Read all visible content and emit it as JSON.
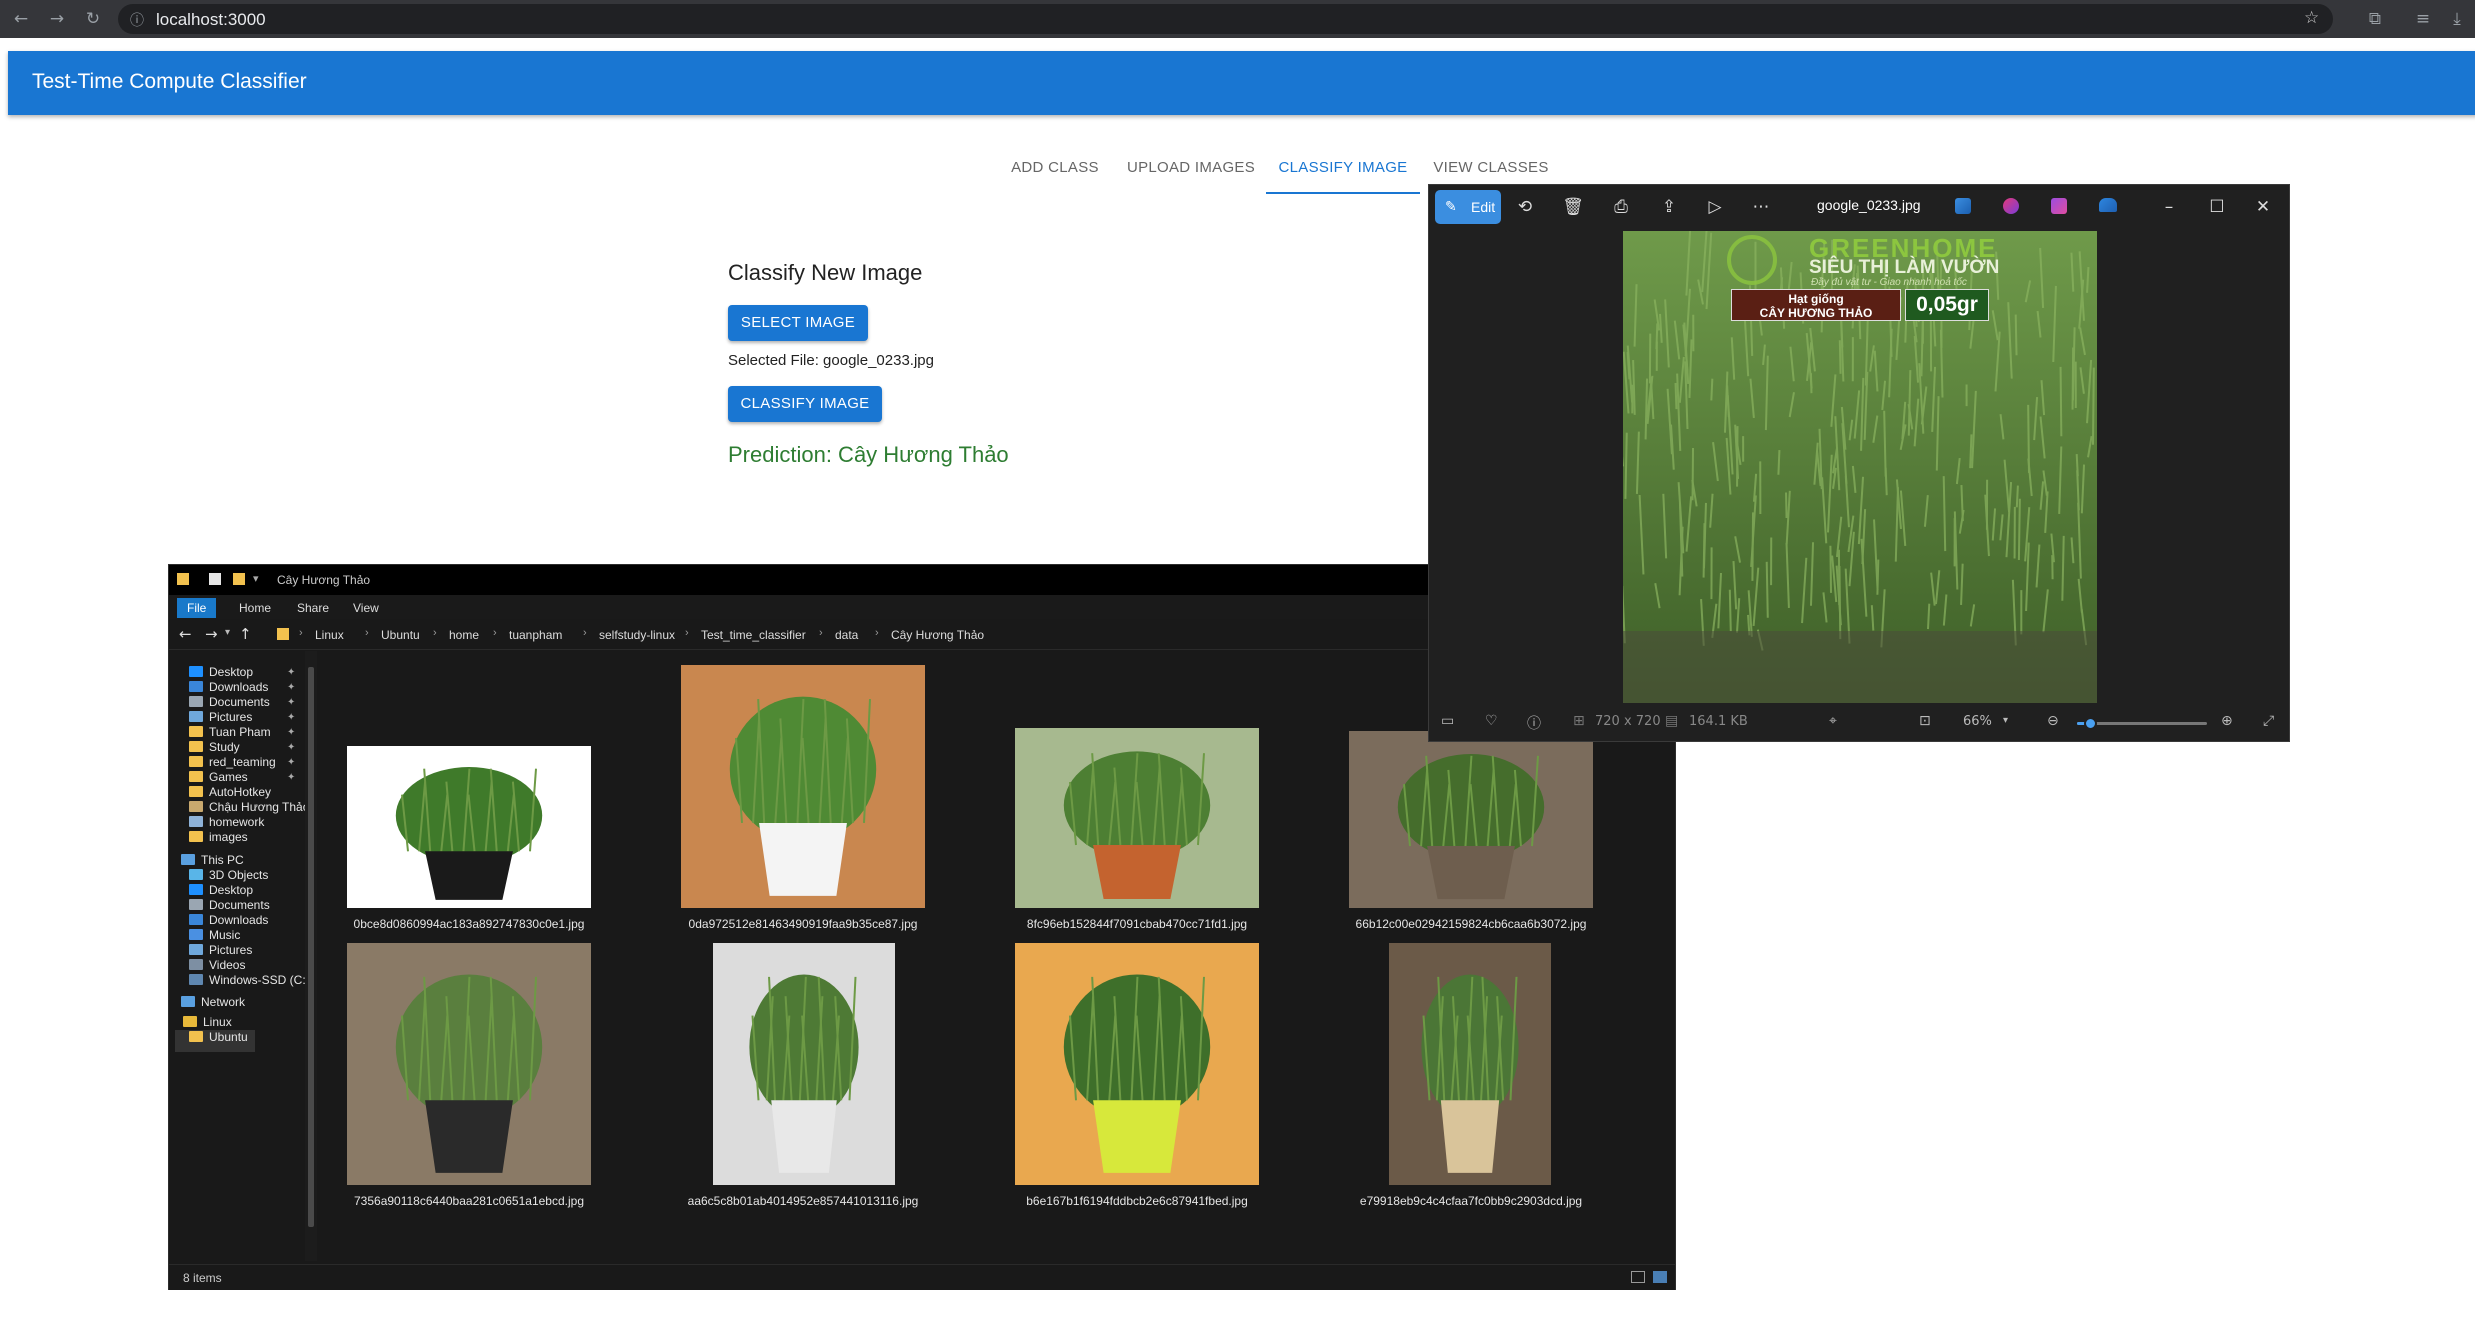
{
  "browser": {
    "url": "localhost:3000"
  },
  "app": {
    "title": "Test-Time Compute Classifier",
    "tabs": [
      "ADD CLASS",
      "UPLOAD IMAGES",
      "CLASSIFY IMAGE",
      "VIEW CLASSES"
    ],
    "active_tab": "CLASSIFY IMAGE",
    "classify": {
      "heading": "Classify New Image",
      "select_button": "SELECT IMAGE",
      "selected_file": "Selected File: google_0233.jpg",
      "classify_button": "CLASSIFY IMAGE",
      "prediction": "Prediction: Cây Hương Thảo"
    }
  },
  "photo_viewer": {
    "edit_label": "Edit",
    "filename": "google_0233.jpg",
    "image_text": {
      "brand": "GREENHOME",
      "store": "SIÊU THỊ LÀM VƯỜN",
      "slogan": "Đầy đủ vật tư - Giao nhanh hoả tốc",
      "seed_label_1": "Hạt giống",
      "seed_label_2": "CÂY HƯƠNG THẢO",
      "weight": "0,05gr"
    },
    "dimensions": "720 x 720",
    "file_size": "164.1 KB",
    "zoom": "66%",
    "zoom_fraction": 0.1
  },
  "explorer": {
    "title": "Cây Hương Thảo",
    "ribbon_tabs": [
      "File",
      "Home",
      "Share",
      "View"
    ],
    "breadcrumb": [
      "Linux",
      "Ubuntu",
      "home",
      "tuanpham",
      "selfstudy-linux",
      "Test_time_classifier",
      "data",
      "Cây Hương Thảo"
    ],
    "nav": [
      {
        "label": "Desktop",
        "pinned": true,
        "color": "#1e90ff"
      },
      {
        "label": "Downloads",
        "pinned": true,
        "color": "#3a86d9"
      },
      {
        "label": "Documents",
        "pinned": true,
        "color": "#9aa6b2"
      },
      {
        "label": "Pictures",
        "pinned": true,
        "color": "#6fa8dc"
      },
      {
        "label": "Tuan Pham",
        "pinned": true,
        "color": "#f2c14e"
      },
      {
        "label": "Study",
        "pinned": true,
        "color": "#f2c14e"
      },
      {
        "label": "red_teaming",
        "pinned": true,
        "color": "#f2c14e"
      },
      {
        "label": "Games",
        "pinned": true,
        "color": "#f2c14e"
      },
      {
        "label": "AutoHotkey",
        "pinned": false,
        "color": "#f2c14e"
      },
      {
        "label": "Chậu Hương Thảo",
        "pinned": false,
        "color": "#c9a96e"
      },
      {
        "label": "homework",
        "pinned": false,
        "color": "#8fb3d9"
      },
      {
        "label": "images",
        "pinned": false,
        "color": "#f2c14e"
      },
      {
        "label": "This PC",
        "pinned": false,
        "color": "#5aa0e0"
      },
      {
        "label": "3D Objects",
        "pinned": false,
        "color": "#59b5e8"
      },
      {
        "label": "Desktop",
        "pinned": false,
        "color": "#1e90ff"
      },
      {
        "label": "Documents",
        "pinned": false,
        "color": "#9aa6b2"
      },
      {
        "label": "Downloads",
        "pinned": false,
        "color": "#3a86d9"
      },
      {
        "label": "Music",
        "pinned": false,
        "color": "#4a90e2"
      },
      {
        "label": "Pictures",
        "pinned": false,
        "color": "#6fa8dc"
      },
      {
        "label": "Videos",
        "pinned": false,
        "color": "#7d8fa3"
      },
      {
        "label": "Windows-SSD (C:)",
        "pinned": false,
        "color": "#5f87b0"
      },
      {
        "label": "Network",
        "pinned": false,
        "color": "#5aa0e0"
      },
      {
        "label": "Linux",
        "pinned": false,
        "color": "#e8b93a"
      },
      {
        "label": "Ubuntu",
        "pinned": false,
        "color": "#f2c14e"
      }
    ],
    "files": [
      {
        "name": "0bce8d0860994ac183a892747830c0e1.jpg",
        "bg": "#ffffff",
        "pot": "#1a1a1a",
        "plant": "#3f7a2a"
      },
      {
        "name": "0da972512e81463490919faa9b35ce87.jpg",
        "bg": "#c9874f",
        "pot": "#f4f4f4",
        "plant": "#4f8a34"
      },
      {
        "name": "8fc96eb152844f7091cbab470cc71fd1.jpg",
        "bg": "#a7b98f",
        "pot": "#c4632f",
        "plant": "#4d7f33"
      },
      {
        "name": "66b12c00e02942159824cb6caa6b3072.jpg",
        "bg": "#7b6c5c",
        "pot": "#6e5e4e",
        "plant": "#456d2c"
      },
      {
        "name": "7356a90118c6440baa281c0651a1ebcd.jpg",
        "bg": "#8a7a66",
        "pot": "#2a2a2a",
        "plant": "#5a7f3e"
      },
      {
        "name": "aa6c5c8b01ab4014952e857441013116.jpg",
        "bg": "#dcdcdc",
        "pot": "#e8e8e8",
        "plant": "#4e7a35"
      },
      {
        "name": "b6e167b1f6194fddbcb2e6c87941fbed.jpg",
        "bg": "#e9a84f",
        "pot": "#d7e83b",
        "plant": "#3e6f2a"
      },
      {
        "name": "e79918eb9c4c4cfaa7fc0bb9c2903dcd.jpg",
        "bg": "#6b5a48",
        "pot": "#d9c49a",
        "plant": "#4b7636"
      }
    ],
    "status": "8 items"
  },
  "colors": {
    "primary": "#1976d2",
    "success": "#2e7d32"
  }
}
